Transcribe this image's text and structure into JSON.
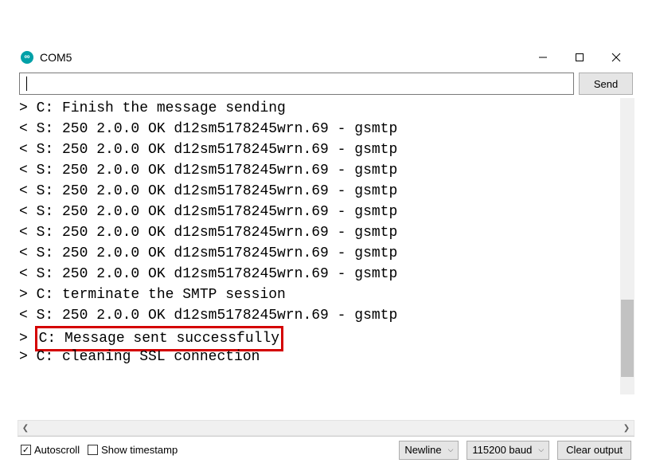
{
  "window": {
    "title": "COM5"
  },
  "toolbar": {
    "input_value": "",
    "send_label": "Send"
  },
  "console": {
    "lines": [
      "> C: Finish the message sending",
      "< S: 250 2.0.0 OK d12sm5178245wrn.69 - gsmtp",
      "< S: 250 2.0.0 OK d12sm5178245wrn.69 - gsmtp",
      "< S: 250 2.0.0 OK d12sm5178245wrn.69 - gsmtp",
      "< S: 250 2.0.0 OK d12sm5178245wrn.69 - gsmtp",
      "< S: 250 2.0.0 OK d12sm5178245wrn.69 - gsmtp",
      "< S: 250 2.0.0 OK d12sm5178245wrn.69 - gsmtp",
      "< S: 250 2.0.0 OK d12sm5178245wrn.69 - gsmtp",
      "< S: 250 2.0.0 OK d12sm5178245wrn.69 - gsmtp",
      "> C: terminate the SMTP session",
      "< S: 250 2.0.0 OK d12sm5178245wrn.69 - gsmtp",
      "> C: Message sent successfully",
      "> C: cleaning SSL connection"
    ],
    "highlighted_index": 11,
    "highlight_prefix": "> ",
    "highlight_text": "C: Message sent successfully"
  },
  "bottom": {
    "autoscroll_label": "Autoscroll",
    "autoscroll_checked": true,
    "timestamp_label": "Show timestamp",
    "timestamp_checked": false,
    "line_ending_value": "Newline",
    "baud_value": "115200 baud",
    "clear_label": "Clear output"
  }
}
